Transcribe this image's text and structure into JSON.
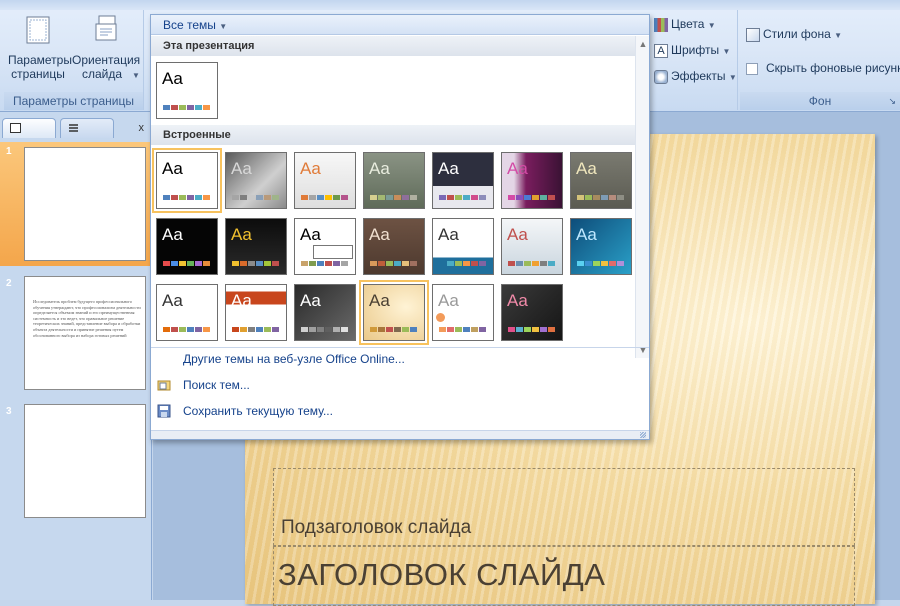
{
  "ribbon": {
    "page_setup_group": {
      "label": "Параметры страницы",
      "page_setup_button": "Параметры страницы",
      "orientation_button": "Ориентация слайда"
    },
    "theme_options": {
      "colors": "Цвета",
      "fonts": "Шрифты",
      "effects": "Эффекты"
    },
    "background_group": {
      "label": "Фон",
      "styles": "Стили фона",
      "hide_graphics": "Скрыть фоновые рисунки"
    }
  },
  "gallery": {
    "header": "Все темы",
    "section_current": "Эта презентация",
    "section_builtin": "Встроенные",
    "aa_text": "Aa",
    "menu": {
      "online": "Другие темы на веб-узле Office Online...",
      "browse": "Поиск тем...",
      "save": "Сохранить текущую тему..."
    }
  },
  "slides_pane": {
    "close": "x",
    "slides": [
      {
        "number": "1"
      },
      {
        "number": "2",
        "text": "Исследователь проблем будущего профессионального обучения утверждают, что профессионализм деятельности определяется объемом знаний и его преимущественная системность и это ведет, что правильное решение теоретических знаний, представление выбора и обработки объекта деятельности и принятие решения путем обоснованного выбора из набора готовых решений"
      },
      {
        "number": "3"
      }
    ]
  },
  "slide": {
    "subtitle": "Подзаголовок слайда",
    "title": "ЗАГОЛОВОК СЛАЙДА"
  }
}
